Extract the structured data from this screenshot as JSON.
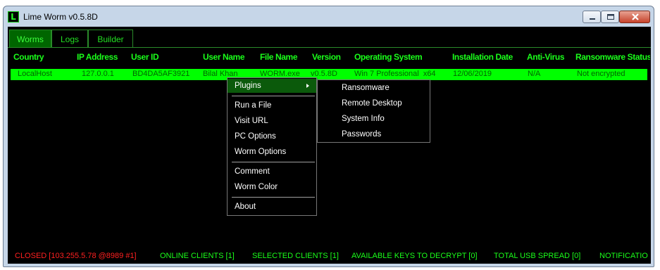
{
  "window": {
    "title": "Lime Worm v0.5.8D",
    "icon_letter": "L"
  },
  "tabs": [
    "Worms",
    "Logs",
    "Builder"
  ],
  "columns": [
    "Country",
    "IP Address",
    "User ID",
    "User Name",
    "File Name",
    "Version",
    "Operating System",
    "Installation Date",
    "Anti-Virus",
    "Ransomware Status"
  ],
  "rows": [
    [
      "LocalHost",
      "127.0.0.1",
      "BD4DA5AF3921",
      "Bilal Khan",
      "WORM.exe",
      "v0.5.8D",
      "Win 7 Professional  x64",
      "12/06/2019",
      "N/A",
      "Not encrypted"
    ]
  ],
  "context_menu": {
    "items": [
      "Plugins",
      "Run a File",
      "Visit URL",
      "PC Options",
      "Worm Options",
      "Comment",
      "Worm Color",
      "About"
    ]
  },
  "submenu": {
    "items": [
      "Ransomware",
      "Remote Desktop",
      "System Info",
      "Passwords"
    ]
  },
  "status_bar": {
    "listener": "CLOSED [103.255.5.78 @8989 #1]",
    "online_clients": "ONLINE CLIENTS [1]",
    "selected_clients": "SELECTED CLIENTS [1]",
    "available_keys": "AVAILABLE KEYS TO DECRYPT [0]",
    "usb_spread": "TOTAL USB SPREAD [0]",
    "notifications": "NOTIFICATIO"
  },
  "colors": {
    "accent_green": "#00ff00",
    "row_text": "#006400",
    "closed_red": "#ff2020",
    "background": "#000000"
  }
}
